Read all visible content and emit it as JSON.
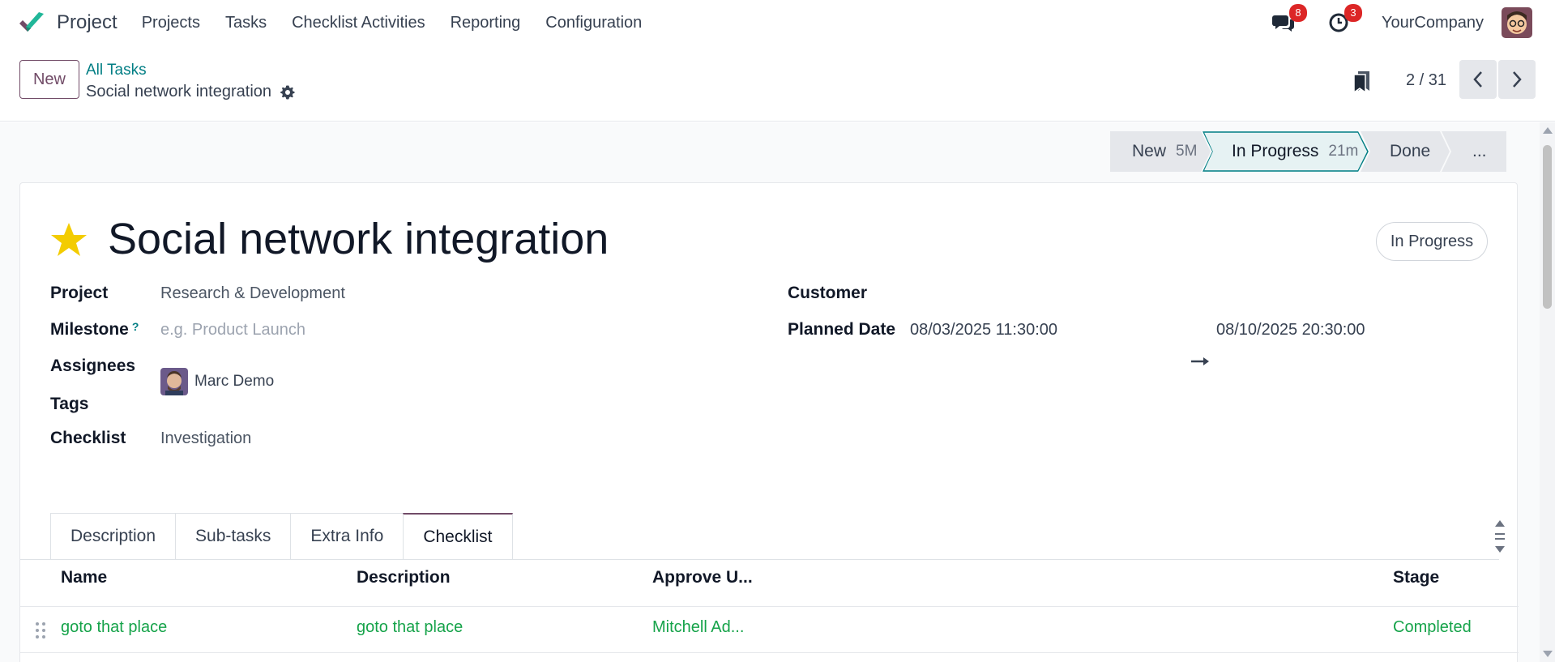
{
  "navbar": {
    "app_name": "Project",
    "menu": [
      "Projects",
      "Tasks",
      "Checklist Activities",
      "Reporting",
      "Configuration"
    ],
    "messages_count": "8",
    "activities_count": "3",
    "company": "YourCompany"
  },
  "control": {
    "new_label": "New",
    "breadcrumb_parent": "All Tasks",
    "breadcrumb_current": "Social network integration",
    "pager": "2 / 31"
  },
  "statusbar": {
    "stages": [
      {
        "label": "New",
        "time": "5M"
      },
      {
        "label": "In Progress",
        "time": "21m"
      },
      {
        "label": "Done",
        "time": ""
      },
      {
        "label": "...",
        "time": ""
      }
    ],
    "active_index": 1
  },
  "form": {
    "title": "Social network integration",
    "state": "In Progress",
    "project_label": "Project",
    "project_value": "Research & Development",
    "milestone_label": "Milestone",
    "milestone_help": "?",
    "milestone_placeholder": "e.g. Product Launch",
    "assignees_label": "Assignees",
    "assignee_name": "Marc Demo",
    "tags_label": "Tags",
    "checklist_label": "Checklist",
    "checklist_value": "Investigation",
    "customer_label": "Customer",
    "planned_label": "Planned Date",
    "planned_start": "08/03/2025 11:30:00",
    "planned_end": "08/10/2025 20:30:00"
  },
  "tabs": [
    "Description",
    "Sub-tasks",
    "Extra Info",
    "Checklist"
  ],
  "active_tab": "Checklist",
  "checklist_table": {
    "columns": [
      "Name",
      "Description",
      "Approve U...",
      "Stage"
    ],
    "rows": [
      {
        "name": "goto that place",
        "description": "goto that place",
        "approve_user": "Mitchell Ad...",
        "stage": "Completed"
      }
    ]
  },
  "colors": {
    "brand": "#714b67",
    "link": "#017e84",
    "completed": "#16a34a",
    "badge": "#dc2626"
  }
}
